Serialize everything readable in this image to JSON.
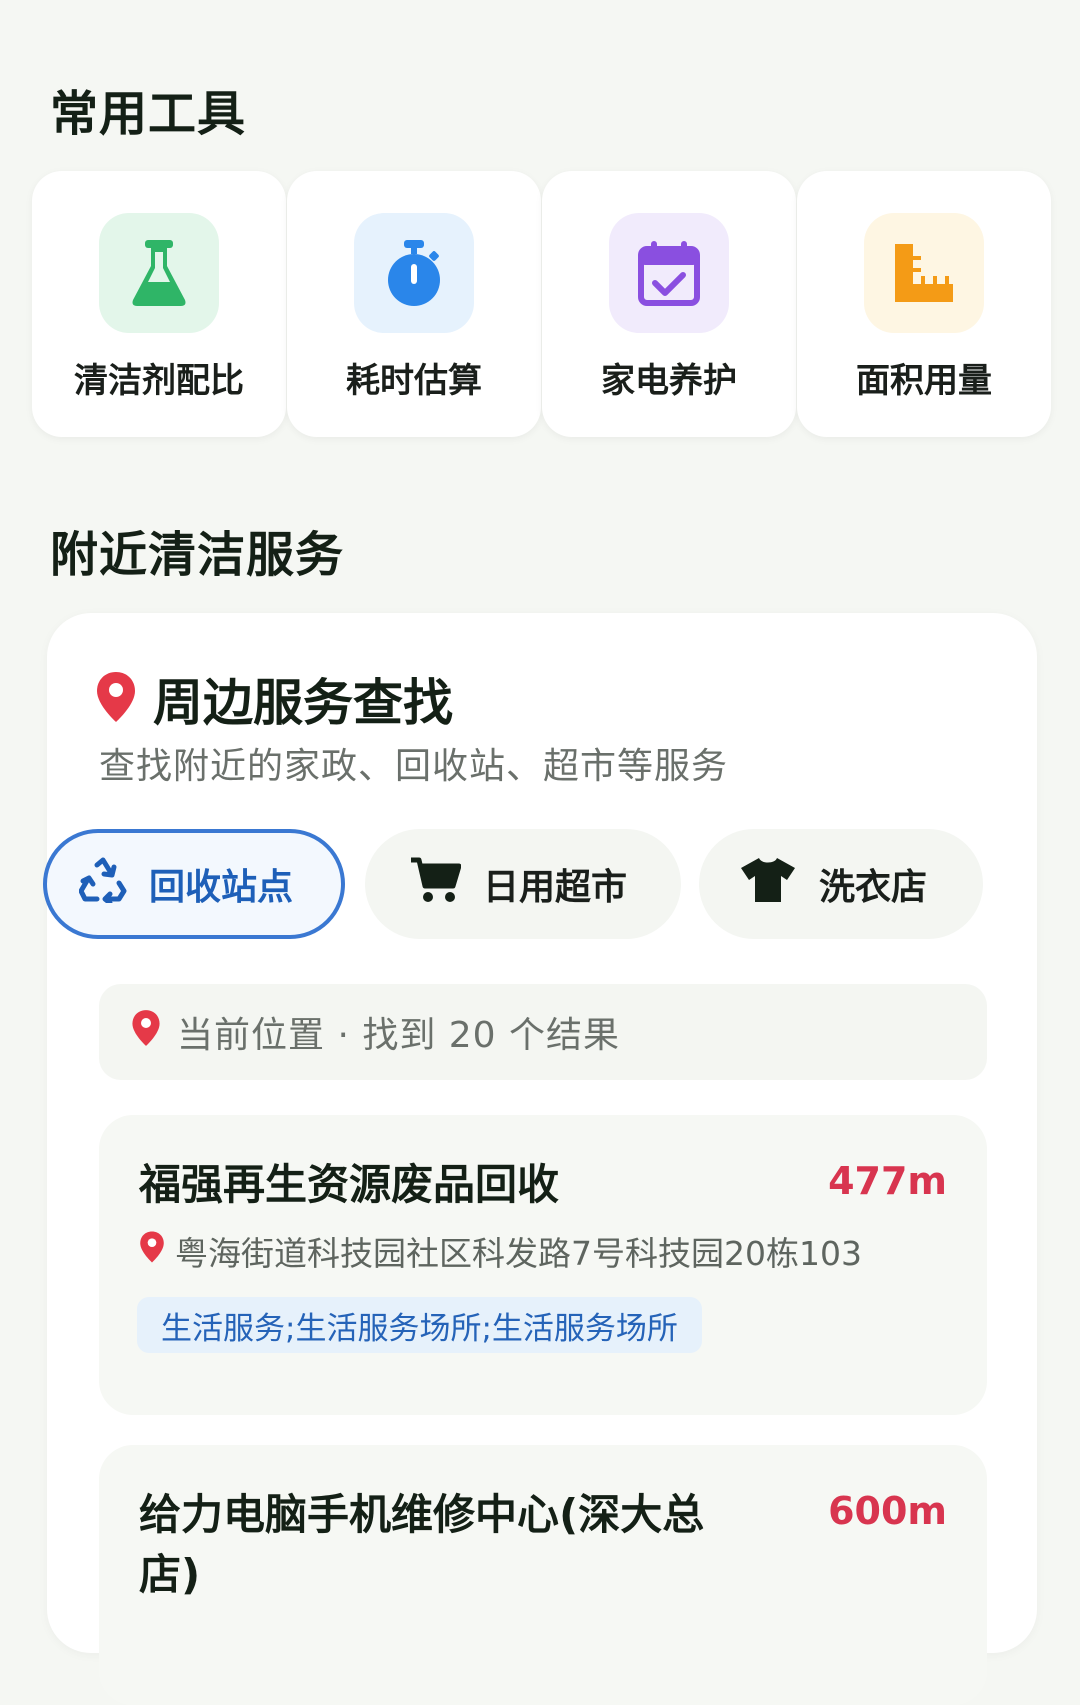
{
  "sections": {
    "tools_title": "常用工具",
    "nearby_title": "附近清洁服务"
  },
  "tools": [
    {
      "label": "清洁剂配比",
      "icon": "flask-icon",
      "color": "#2fb567",
      "bg": "#e3f6ea"
    },
    {
      "label": "耗时估算",
      "icon": "stopwatch-icon",
      "color": "#2a86ea",
      "bg": "#e6f2fd"
    },
    {
      "label": "家电养护",
      "icon": "calendar-check-icon",
      "color": "#8a4fe0",
      "bg": "#f1ebfc"
    },
    {
      "label": "面积用量",
      "icon": "ruler-icon",
      "color": "#f49b16",
      "bg": "#fef6e3"
    }
  ],
  "service": {
    "title": "周边服务查找",
    "subtitle": "查找附近的家政、回收站、超市等服务",
    "pin_color": "#e53948",
    "chips": [
      {
        "label": "回收站点",
        "icon": "recycle-icon",
        "selected": true
      },
      {
        "label": "日用超市",
        "icon": "shopping-cart-icon",
        "selected": false
      },
      {
        "label": "洗衣店",
        "icon": "tshirt-icon",
        "selected": false
      }
    ],
    "location_summary": "当前位置 · 找到 20 个结果",
    "results": [
      {
        "name": "福强再生资源废品回收",
        "distance": "477m",
        "address": "粤海街道科技园社区科发路7号科技园20栋103",
        "tag": "生活服务;生活服务场所;生活服务场所"
      },
      {
        "name": "给力电脑手机维修中心(深大总店)",
        "distance": "600m"
      }
    ]
  }
}
